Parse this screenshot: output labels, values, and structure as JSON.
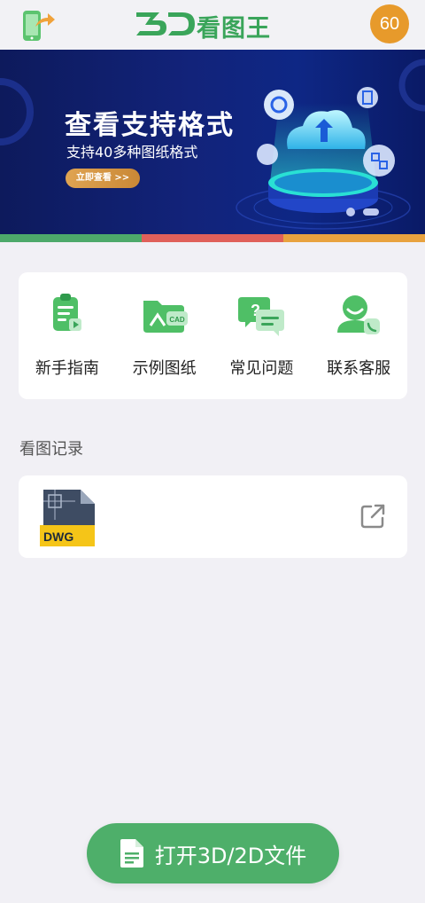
{
  "header": {
    "logo_text": "看图王",
    "logo_mark": "3D",
    "coins": "60",
    "share_icon": "phone-share-icon"
  },
  "banner": {
    "title": "查看支持格式",
    "subtitle": "支持40多种图纸格式",
    "button_label": "立即查看 >>",
    "stripe_colors": [
      "#4da96a",
      "#e0605a",
      "#e8a23f"
    ]
  },
  "actions": [
    {
      "label": "新手指南",
      "icon": "guide-icon"
    },
    {
      "label": "示例图纸",
      "icon": "cad-folder-icon"
    },
    {
      "label": "常见问题",
      "icon": "faq-icon"
    },
    {
      "label": "联系客服",
      "icon": "support-icon"
    }
  ],
  "history": {
    "section_title": "看图记录",
    "records": [
      {
        "file_type": "DWG",
        "name": "",
        "meta": ""
      }
    ]
  },
  "bottom": {
    "open_label": "打开3D/2D文件"
  },
  "colors": {
    "accent": "#4eaf6a",
    "coin": "#e79a2b",
    "background": "#f1f0f5"
  }
}
